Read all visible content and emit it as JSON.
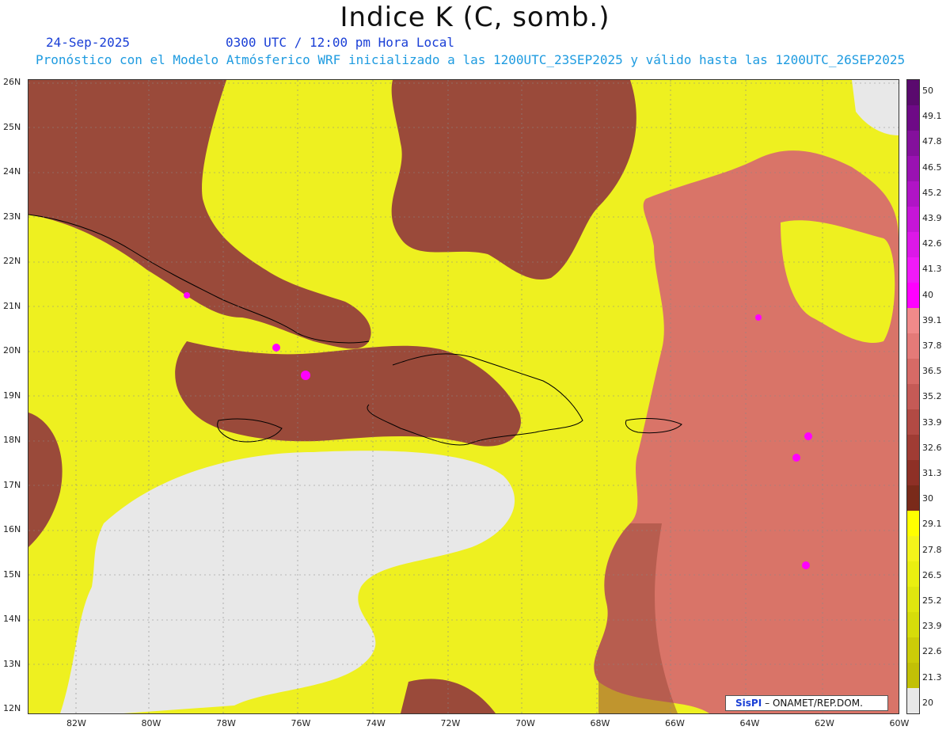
{
  "title": "Indice K (C, somb.)",
  "date": "24-Sep-2025",
  "time": "0300 UTC / 12:00 pm Hora Local",
  "description": "Pronóstico con el Modelo Atmósferico WRF inicializado a las 1200UTC_23SEP2025 y válido hasta las  1200UTC_26SEP2025",
  "lat_labels": [
    "26N",
    "25N",
    "24N",
    "23N",
    "22N",
    "21N",
    "20N",
    "19N",
    "18N",
    "17N",
    "16N",
    "15N",
    "14N",
    "13N",
    "12N"
  ],
  "lon_labels": [
    "82W",
    "80W",
    "78W",
    "76W",
    "74W",
    "72W",
    "70W",
    "68W",
    "66W",
    "64W",
    "62W",
    "60W"
  ],
  "colorbar": {
    "labels": [
      "50",
      "49.1",
      "47.8",
      "46.5",
      "45.2",
      "43.9",
      "42.6",
      "41.3",
      "40",
      "39.1",
      "37.8",
      "36.5",
      "35.2",
      "33.9",
      "32.6",
      "31.3",
      "30",
      "29.1",
      "27.8",
      "26.5",
      "25.2",
      "23.9",
      "22.6",
      "21.3",
      "20"
    ],
    "colors": [
      "#5a0a6e",
      "#6e0a86",
      "#84109c",
      "#9a12b2",
      "#b014c6",
      "#c616d8",
      "#dc18e8",
      "#f01af8",
      "#ff00ff",
      "#f08a8a",
      "#e47a78",
      "#d66a66",
      "#c55a56",
      "#b24a44",
      "#a03c34",
      "#8e3026",
      "#7a2a1a",
      "#ffff00",
      "#f4f41a",
      "#eaef10",
      "#e0e60e",
      "#d6dc0a",
      "#cccc08",
      "#c2c006",
      "#e8e8e8"
    ]
  },
  "credit": {
    "brand": "SisPI",
    "text": "– ONAMET/REP.DOM."
  }
}
